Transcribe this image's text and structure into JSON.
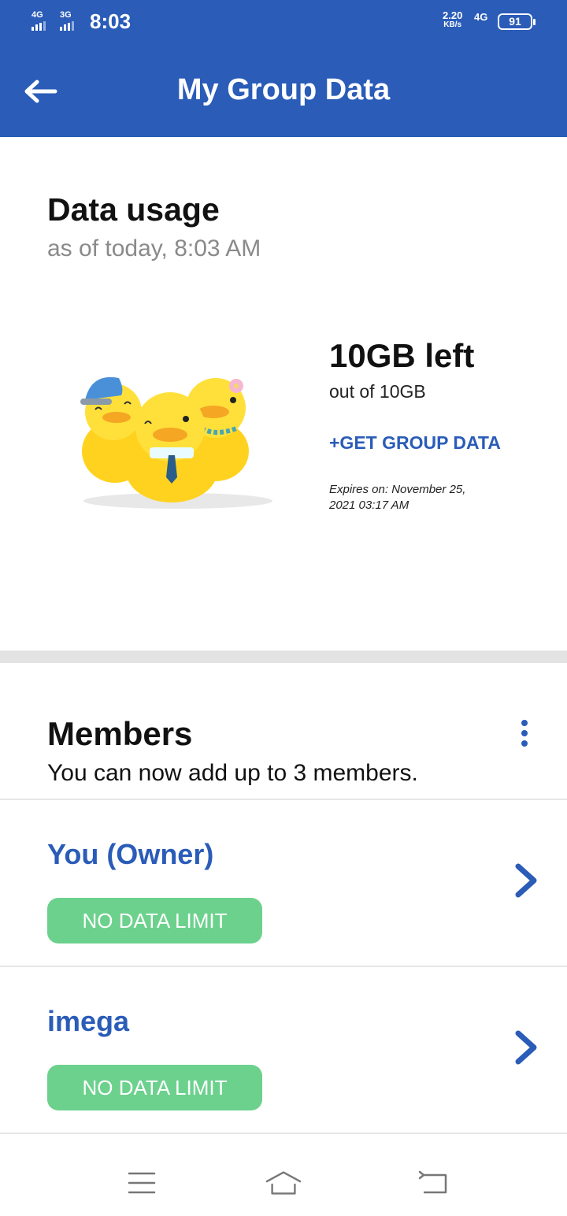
{
  "status_bar": {
    "sim1": "4G",
    "sim2": "3G",
    "time": "8:03",
    "net_speed": "2.20",
    "net_speed_unit": "KB/s",
    "network": "4G",
    "battery": "91"
  },
  "header": {
    "title": "My Group Data",
    "back_icon": "arrow-left-icon"
  },
  "usage": {
    "title": "Data usage",
    "subtitle": "as of today, 8:03 AM",
    "left": "10GB left",
    "out_of": "out of 10GB",
    "get_group_data": "+GET GROUP DATA",
    "expires": "Expires on: November 25, 2021 03:17 AM"
  },
  "members": {
    "title": "Members",
    "subtitle": "You can now add up to 3 members.",
    "menu_icon": "more-vertical-icon",
    "list": [
      {
        "name": "You (Owner)",
        "badge": "NO DATA LIMIT"
      },
      {
        "name": "imega",
        "badge": "NO DATA LIMIT"
      }
    ]
  },
  "colors": {
    "primary": "#2a5cb8",
    "badge_green": "#6cd18d",
    "duck_yellow": "#ffd21f"
  },
  "nav": {
    "menu_icon": "menu-icon",
    "home_icon": "home-icon",
    "back_icon": "back-icon"
  }
}
